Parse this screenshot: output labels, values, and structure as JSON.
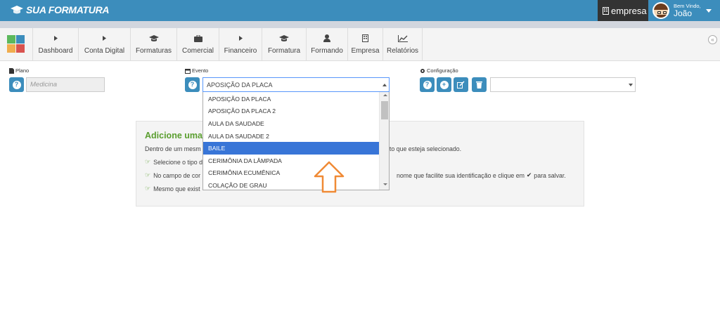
{
  "header": {
    "brand": "SUA FORMATURA",
    "company_label": "empresa",
    "welcome": "Bem Vindo,",
    "user_name": "João"
  },
  "nav": {
    "items": [
      {
        "label": "Dashboard",
        "icon": "caret-right-icon"
      },
      {
        "label": "Conta Digital",
        "icon": "caret-right-icon"
      },
      {
        "label": "Formaturas",
        "icon": "graduation-cap-icon"
      },
      {
        "label": "Comercial",
        "icon": "briefcase-icon"
      },
      {
        "label": "Financeiro",
        "icon": "caret-right-icon"
      },
      {
        "label": "Formatura",
        "icon": "graduation-cap-icon"
      },
      {
        "label": "Formando",
        "icon": "user-icon"
      },
      {
        "label": "Empresa",
        "icon": "building-icon"
      },
      {
        "label": "Relatórios",
        "icon": "line-chart-icon"
      }
    ],
    "logo_colors": [
      "#5cb85c",
      "#3c8dbc",
      "#f0ad4e",
      "#d9534f"
    ]
  },
  "form": {
    "plano_label": "Plano",
    "plano_placeholder": "Medicina",
    "evento_label": "Evento",
    "evento_value": "APOSIÇÃO DA PLACA",
    "config_label": "Configuração",
    "config_value": ""
  },
  "dropdown": {
    "options": [
      "APOSIÇÃO DA PLACA",
      "APOSIÇÃO DA PLACA 2",
      "AULA DA SAUDADE",
      "AULA DA SAUDADE 2",
      "BAILE",
      "CERIMÔNIA DA LÂMPADA",
      "CERIMÔNIA ECUMÊNICA",
      "COLAÇÃO DE GRAU"
    ],
    "selected": "BAILE"
  },
  "panel": {
    "title": "Adicione uma c",
    "line1": "Dentro de um mesm",
    "line1_tail": "nto que esteja selecionado.",
    "line2": "Selecione o tipo d",
    "line3": "No campo de cor",
    "line3_tail_a": "nome que facilite sua identificação e clique em",
    "line3_tail_b": "para salvar.",
    "line4": "Mesmo que exist"
  },
  "colors": {
    "header_blue": "#3c8dbc",
    "selected_option": "#3875d7",
    "panel_title_green": "#5a9e2f",
    "annotation_arrow": "#f08a35"
  }
}
